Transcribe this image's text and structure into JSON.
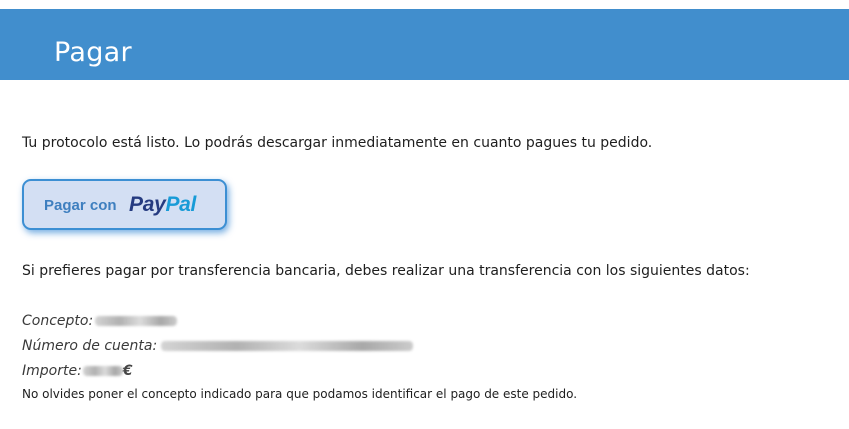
{
  "header": {
    "title": "Pagar",
    "background_color": "#418ecd"
  },
  "intro_text": "Tu protocolo está listo. Lo podrás descargar inmediatamente en cuanto pagues tu pedido.",
  "paypal_button": {
    "label": "Pagar con",
    "logo_pay": "Pay",
    "logo_pal": "Pal",
    "background_color": "#d3dff3",
    "border_color": "#3c8fd3"
  },
  "transfer_text": "Si prefieres pagar por transferencia bancaria, debes realizar una transferencia con los siguientes datos:",
  "details": {
    "concepto_label": "Concepto:",
    "cuenta_label": "Número de cuenta:",
    "importe_label": "Importe:",
    "currency_symbol": "€"
  },
  "note": "No olvides poner el concepto indicado para que podamos identificar el pago de este pedido."
}
